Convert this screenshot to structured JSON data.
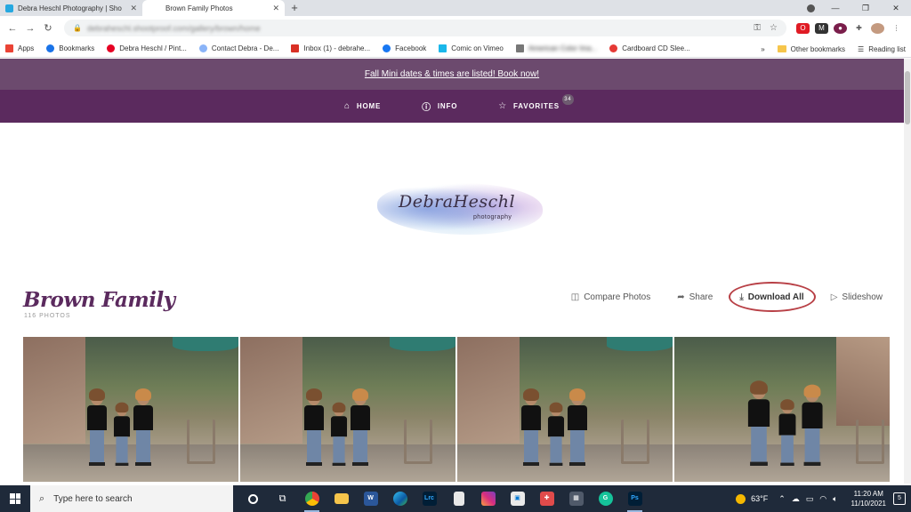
{
  "browser": {
    "tabs": [
      {
        "title": "Debra Heschl Photography | Sho",
        "active": false
      },
      {
        "title": "Brown Family Photos",
        "active": true
      }
    ],
    "new_tab_glyph": "+",
    "address": {
      "url": "debraheschl.shootproof.com/gallery/brown/home"
    },
    "bookmarks": [
      {
        "label": "Apps",
        "icon": "apps-grid-icon",
        "color": "#ea4335"
      },
      {
        "label": "Bookmarks",
        "icon": "star-icon",
        "color": "#1a73e8"
      },
      {
        "label": "Debra Heschl / Pint...",
        "icon": "pinterest-icon",
        "color": "#e60023"
      },
      {
        "label": "Contact Debra - De...",
        "icon": "cloud-icon",
        "color": "#8ab4f8"
      },
      {
        "label": "Inbox (1) - debrahe...",
        "icon": "gmail-icon",
        "color": "#d93025"
      },
      {
        "label": "Facebook",
        "icon": "facebook-icon",
        "color": "#1877f2"
      },
      {
        "label": "Comic on Vimeo",
        "icon": "vimeo-icon",
        "color": "#1ab7ea"
      },
      {
        "label": "American Color Ima...",
        "icon": "bookmark-icon",
        "color": "#777777",
        "blurred": true
      },
      {
        "label": "Cardboard CD Slee...",
        "icon": "cd-icon",
        "color": "#e53935"
      }
    ],
    "overflow": "»",
    "other_bookmarks": "Other bookmarks",
    "reading_list": "Reading list"
  },
  "page": {
    "promo": "Fall Mini dates & times are listed! Book now!",
    "nav": [
      {
        "label": "HOME",
        "icon": "home-icon"
      },
      {
        "label": "INFO",
        "icon": "info-icon"
      },
      {
        "label": "FAVORITES",
        "icon": "star-outline-icon",
        "badge": "34"
      }
    ],
    "logo": {
      "name": "DebraHeschl",
      "sub": "photography"
    },
    "gallery": {
      "title": "Brown Family",
      "count": "116 PHOTOS",
      "actions": {
        "compare": "Compare Photos",
        "share": "Share",
        "download": "Download All",
        "slideshow": "Slideshow"
      }
    },
    "colors": {
      "nav_purple": "#5b2a5e",
      "promo_purple": "#6c4a6e",
      "annotation_red": "#b84046"
    }
  },
  "taskbar": {
    "search_placeholder": "Type here to search",
    "apps": [
      "task-view-icon",
      "chrome-icon",
      "file-explorer-icon",
      "word-icon",
      "edge-icon",
      "lightroom-icon",
      "file-icon",
      "instagram-icon",
      "store-icon",
      "gift-icon",
      "calculator-icon",
      "grammarly-icon",
      "photoshop-icon"
    ],
    "app_labels": {
      "word": "W",
      "lightroom": "Lrc",
      "photoshop": "Ps",
      "grammarly": "G"
    },
    "weather": "63°F",
    "time": "11:20 AM",
    "date": "11/10/2021",
    "notifications": "5"
  }
}
